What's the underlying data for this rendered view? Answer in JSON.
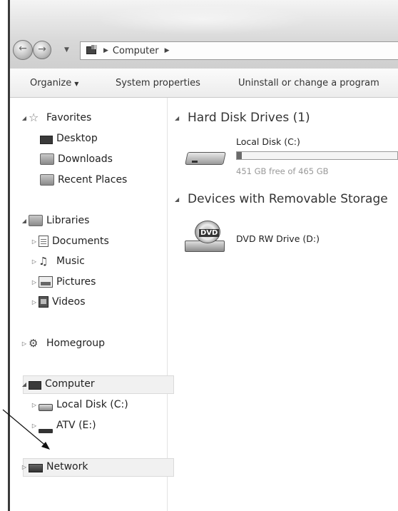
{
  "window": {
    "address_path": [
      "Computer"
    ]
  },
  "toolbar": {
    "organize_label": "Organize",
    "system_properties_label": "System properties",
    "uninstall_label": "Uninstall or change a program"
  },
  "nav_pane": {
    "favorites": {
      "label": "Favorites",
      "items": [
        {
          "label": "Desktop",
          "icon": "desktop-icon"
        },
        {
          "label": "Downloads",
          "icon": "downloads-icon"
        },
        {
          "label": "Recent Places",
          "icon": "recent-places-icon"
        }
      ]
    },
    "libraries": {
      "label": "Libraries",
      "items": [
        {
          "label": "Documents",
          "icon": "documents-icon"
        },
        {
          "label": "Music",
          "icon": "music-icon"
        },
        {
          "label": "Pictures",
          "icon": "pictures-icon"
        },
        {
          "label": "Videos",
          "icon": "videos-icon"
        }
      ]
    },
    "homegroup": {
      "label": "Homegroup"
    },
    "computer": {
      "label": "Computer",
      "items": [
        {
          "label": "Local Disk (C:)",
          "icon": "local-disk-icon"
        },
        {
          "label": "ATV (E:)",
          "icon": "usb-drive-icon"
        }
      ]
    },
    "network": {
      "label": "Network"
    }
  },
  "main": {
    "hard_disk_group": {
      "header": "Hard Disk Drives (1)",
      "drives": [
        {
          "label": "Local Disk (C:)",
          "free_text": "451 GB free of 465 GB",
          "used_fraction": 0.03
        }
      ]
    },
    "removable_group": {
      "header": "Devices with Removable Storage",
      "devices": [
        {
          "label": "DVD RW Drive (D:)",
          "badge": "DVD"
        }
      ]
    }
  }
}
